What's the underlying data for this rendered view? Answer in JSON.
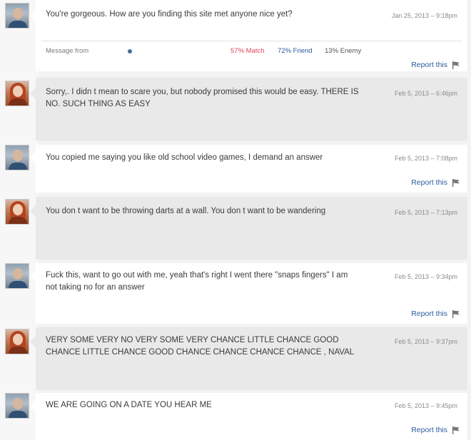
{
  "colors": {
    "match": "#e0445f",
    "friend": "#2a5b9f",
    "report": "#2a5b9f"
  },
  "messages": [
    {
      "sender": "male",
      "text": "You're gorgeous. How are you finding this site met anyone nice yet?",
      "date": "Jan 25, 2013 – 9:18pm",
      "meta": {
        "from_label": "Message from",
        "match": "57% Match",
        "friend": "72% Friend",
        "enemy": "13% Enemy"
      },
      "report": "Report this"
    },
    {
      "sender": "female",
      "text": "Sorry,. I didn t mean to scare you, but nobody promised this would be easy. THERE IS NO. SUCH THING AS EASY",
      "date": "Feb 5, 2013 – 6:46pm"
    },
    {
      "sender": "male",
      "text": "You copied me saying you like old school video games, I demand an answer",
      "date": "Feb 5, 2013 – 7:08pm",
      "report": "Report this"
    },
    {
      "sender": "female",
      "text": "You don t want to be throwing darts at a wall. You don t want to be wandering",
      "date": "Feb 5, 2013 – 7:13pm"
    },
    {
      "sender": "male",
      "text": "Fuck this, want to go out with me, yeah that's right I went there \"snaps fingers\" I am not taking no for an answer",
      "date": "Feb 5, 2013 – 9:34pm",
      "report": "Report this"
    },
    {
      "sender": "female",
      "text": "VERY SOME VERY NO VERY SOME VERY CHANCE LITTLE CHANCE GOOD CHANCE LITTLE CHANCE GOOD CHANCE CHANCE CHANCE CHANCE , NAVAL",
      "date": "Feb 5, 2013 – 9:37pm"
    },
    {
      "sender": "male",
      "text": "WE ARE GOING ON A DATE YOU HEAR ME",
      "date": "Feb 5, 2013 – 9:45pm",
      "report": "Report this"
    }
  ]
}
